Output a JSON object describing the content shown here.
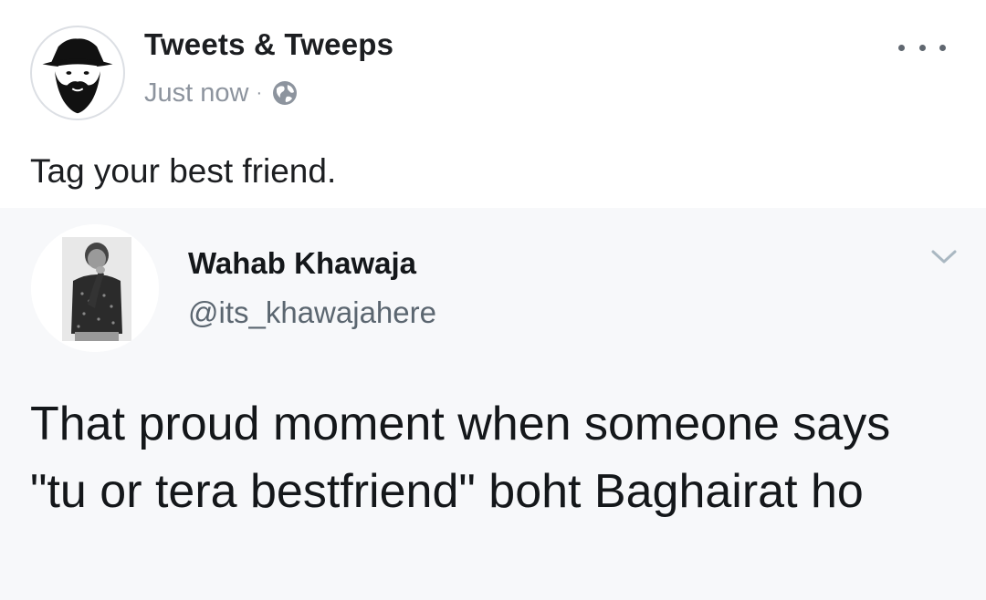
{
  "post": {
    "page_name": "Tweets & Tweeps",
    "timestamp": "Just now",
    "separator": "·",
    "privacy_icon": "globe-icon",
    "more_icon": "ellipsis-icon",
    "text": "Tag your best friend."
  },
  "tweet": {
    "author_name": "Wahab Khawaja",
    "handle": "@its_khawajahere",
    "menu_icon": "chevron-down-icon",
    "text": "That proud moment when someone says \"tu or tera bestfriend\" boht Baghairat ho"
  },
  "colors": {
    "primary_text": "#1c1e21",
    "meta_text": "#8d949e",
    "tweet_background": "#f7f8fa",
    "chevron": "#aab8c2"
  }
}
